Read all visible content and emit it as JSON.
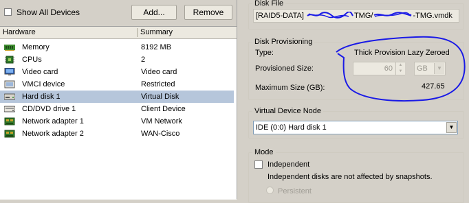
{
  "toolbar": {
    "show_all_devices_label": "Show All Devices",
    "add_label": "Add...",
    "remove_label": "Remove"
  },
  "hardware_table": {
    "columns": [
      "Hardware",
      "Summary"
    ],
    "rows": [
      {
        "name": "Memory",
        "summary": "8192 MB",
        "icon": "memory-icon"
      },
      {
        "name": "CPUs",
        "summary": "2",
        "icon": "cpu-icon"
      },
      {
        "name": "Video card",
        "summary": "Video card",
        "icon": "monitor-icon"
      },
      {
        "name": "VMCI device",
        "summary": "Restricted",
        "icon": "vmci-device-icon"
      },
      {
        "name": "Hard disk 1",
        "summary": "Virtual Disk",
        "icon": "hard-disk-icon",
        "selected": true
      },
      {
        "name": "CD/DVD drive 1",
        "summary": "Client Device",
        "icon": "cd-dvd-icon"
      },
      {
        "name": "Network adapter 1",
        "summary": "VM Network",
        "icon": "network-adapter-icon"
      },
      {
        "name": "Network adapter 2",
        "summary": "WAN-Cisco",
        "icon": "network-adapter-icon"
      }
    ]
  },
  "disk_file": {
    "legend": "Disk File",
    "path_prefix": "[RAID5-DATA] ",
    "path_suffix": "TMG/",
    "path_end": "-TMG.vmdk"
  },
  "disk_provisioning": {
    "legend": "Disk Provisioning",
    "type_label": "Type:",
    "type_value": "Thick Provision Lazy Zeroed",
    "provisioned_label": "Provisioned Size:",
    "provisioned_value": "60",
    "unit_value": "GB",
    "max_label": "Maximum Size (GB):",
    "max_value": "427.65"
  },
  "virtual_device_node": {
    "legend": "Virtual Device Node",
    "selected": "IDE (0:0) Hard disk 1"
  },
  "mode": {
    "legend": "Mode",
    "independent_label": "Independent",
    "independent_desc": "Independent disks are not affected by snapshots.",
    "persistent_label": "Persistent"
  },
  "colors": {
    "selection": "#b6c6db",
    "annotation": "#1a1ae6",
    "panel": "#d4d0c8"
  }
}
